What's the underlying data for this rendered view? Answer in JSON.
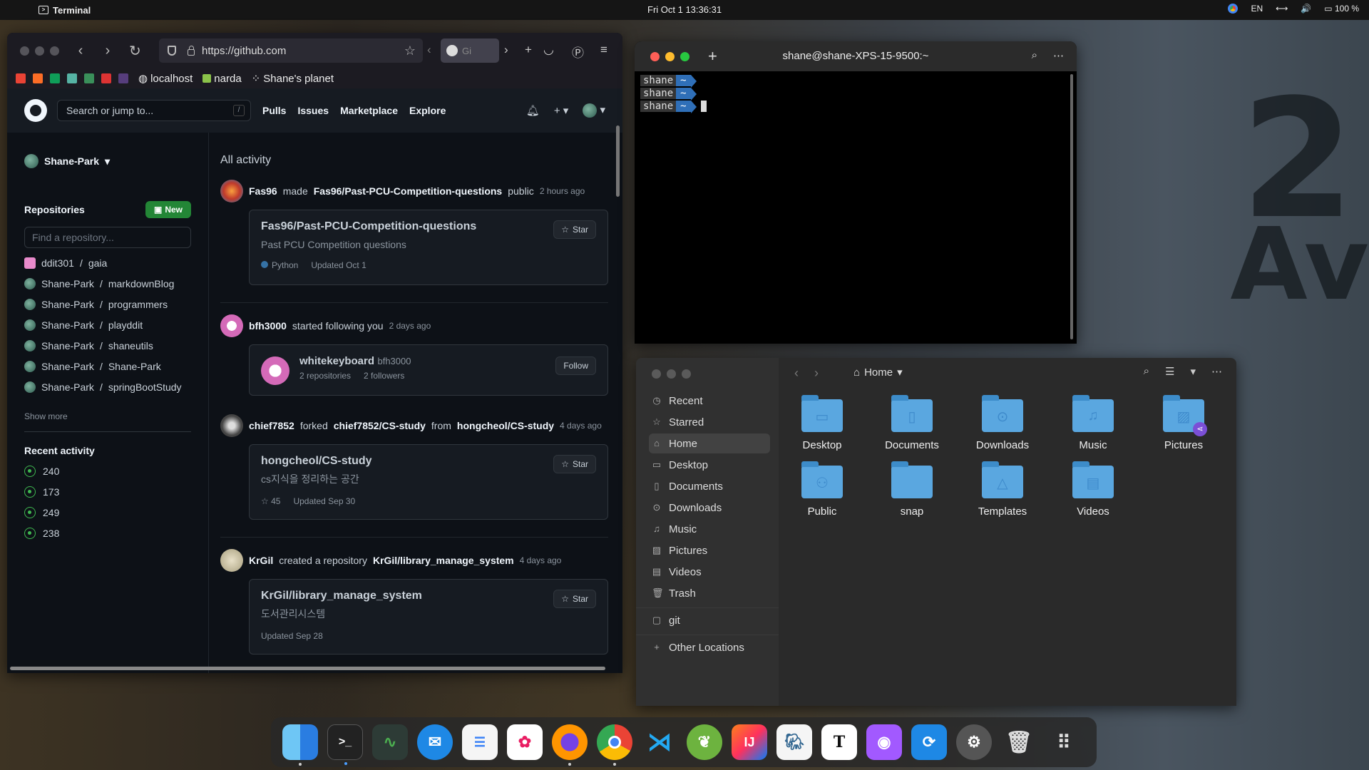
{
  "topbar": {
    "app_name": "Terminal",
    "clock": "Fri Oct 1  13:36:31",
    "lang": "EN",
    "battery": "100 %"
  },
  "browser": {
    "url": "https://github.com",
    "tab_label": "Gi",
    "bookmarks": [
      "localhost",
      "narda",
      "Shane's planet"
    ]
  },
  "github": {
    "search_placeholder": "Search or jump to...",
    "slash": "/",
    "nav": [
      "Pulls",
      "Issues",
      "Marketplace",
      "Explore"
    ],
    "user": "Shane-Park",
    "repos_title": "Repositories",
    "new_label": "New",
    "find_placeholder": "Find a repository...",
    "repos": [
      {
        "owner": "ddit301",
        "name": "gaia"
      },
      {
        "owner": "Shane-Park",
        "name": "markdownBlog"
      },
      {
        "owner": "Shane-Park",
        "name": "programmers"
      },
      {
        "owner": "Shane-Park",
        "name": "playddit"
      },
      {
        "owner": "Shane-Park",
        "name": "shaneutils"
      },
      {
        "owner": "Shane-Park",
        "name": "Shane-Park"
      },
      {
        "owner": "Shane-Park",
        "name": "springBootStudy"
      }
    ],
    "show_more": "Show more",
    "recent_title": "Recent activity",
    "recent": [
      "240",
      "173",
      "249",
      "238"
    ],
    "feed_title": "All activity",
    "events": [
      {
        "actor": "Fas96",
        "verb": "made",
        "target": "Fas96/Past-PCU-Competition-questions",
        "suffix": "public",
        "time": "2 hours ago",
        "card": {
          "name": "Fas96/Past-PCU-Competition-questions",
          "desc": "Past PCU Competition questions",
          "lang": "Python",
          "updated": "Updated Oct 1",
          "button": "Star"
        }
      },
      {
        "actor": "bfh3000",
        "verb": "started following you",
        "time": "2 days ago",
        "card": {
          "name": "whitekeyboard",
          "handle": "bfh3000",
          "repos": "2 repositories",
          "followers": "2 followers",
          "button": "Follow"
        }
      },
      {
        "actor": "chief7852",
        "verb": "forked",
        "target": "chief7852/CS-study",
        "from_word": "from",
        "source": "hongcheol/CS-study",
        "time": "4 days ago",
        "card": {
          "name": "hongcheol/CS-study",
          "desc": "cs지식을 정리하는 공간",
          "stars": "45",
          "updated": "Updated Sep 30",
          "button": "Star"
        }
      },
      {
        "actor": "KrGil",
        "verb": "created a repository",
        "target": "KrGil/library_manage_system",
        "time": "4 days ago",
        "card": {
          "name": "KrGil/library_manage_system",
          "desc": "도서관리시스템",
          "updated": "Updated Sep 28",
          "button": "Star"
        }
      }
    ]
  },
  "terminal": {
    "title": "shane@shane-XPS-15-9500:~",
    "prompts": [
      {
        "user": "shane",
        "dir": "~"
      },
      {
        "user": "shane",
        "dir": "~"
      },
      {
        "user": "shane",
        "dir": "~"
      }
    ]
  },
  "files": {
    "path": "Home",
    "sidebar": [
      "Recent",
      "Starred",
      "Home",
      "Desktop",
      "Documents",
      "Downloads",
      "Music",
      "Pictures",
      "Videos",
      "Trash",
      "git",
      "Other Locations"
    ],
    "folders": [
      "Desktop",
      "Documents",
      "Downloads",
      "Music",
      "Pictures",
      "Public",
      "snap",
      "Templates",
      "Videos"
    ]
  },
  "dock": [
    "Finder",
    "Terminal",
    "System Monitor",
    "Thunderbird",
    "Tasks",
    "Photos",
    "Firefox",
    "Chrome",
    "VS Code",
    "Spring Tools",
    "IntelliJ IDEA",
    "Pgadmin",
    "Typora",
    "GitHub",
    "Software Updater",
    "Settings",
    "Trash",
    "Show Applications"
  ],
  "colors": {
    "accent_green": "#238636",
    "terminal_dir": "#2f6fb8",
    "folder": "#5aa7e0",
    "github_bg": "#0d1117"
  }
}
